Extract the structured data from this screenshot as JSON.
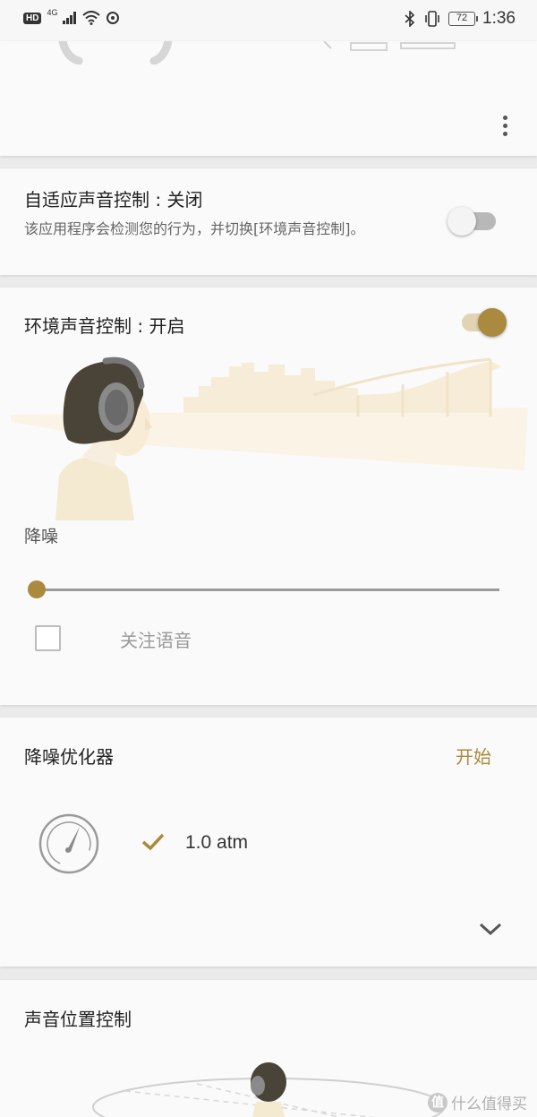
{
  "status_bar": {
    "hd": "HD",
    "network": "4G",
    "battery": "72",
    "time": "1:36",
    "icons": [
      "signal-icon",
      "wifi-icon",
      "sync-icon",
      "bluetooth-icon",
      "vibrate-icon"
    ]
  },
  "adaptive_sound": {
    "title": "自适应声音控制 : 关闭",
    "description": "该应用程序会检测您的行为，并切换[环境声音控制]。",
    "enabled": false
  },
  "ambient_sound": {
    "title": "环境声音控制 : 开启",
    "enabled": true,
    "mode_label": "降噪",
    "level": 0,
    "focus_voice_label": "关注语音",
    "focus_voice_checked": false
  },
  "nc_optimizer": {
    "title": "降噪优化器",
    "start_label": "开始",
    "pressure_value": "1.0 atm"
  },
  "sound_position": {
    "title": "声音位置控制"
  },
  "watermark": {
    "logo": "值",
    "text": "什么值得买"
  },
  "colors": {
    "accent": "#a98a3e",
    "accent_track": "#e1d3b3",
    "card_bg": "#fafafa",
    "page_bg": "#ebebeb"
  }
}
